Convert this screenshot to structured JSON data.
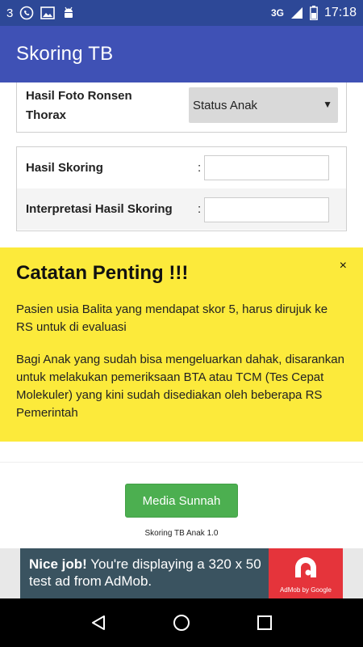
{
  "status_bar": {
    "notification_count": "3",
    "network": "3G",
    "time": "17:18",
    "icons": [
      "whatsapp-icon",
      "image-icon",
      "android-icon",
      "signal-icon",
      "battery-icon"
    ]
  },
  "app_bar": {
    "title": "Skoring TB",
    "color": "#3f51b5"
  },
  "form": {
    "xray_label": "Hasil Foto Ronsen Thorax",
    "xray_select_value": "Status Anak",
    "score_label": "Hasil Skoring",
    "score_colon": ":",
    "score_value": "",
    "interpretation_label": "Interpretasi Hasil Skoring",
    "interpretation_colon": ":",
    "interpretation_value": ""
  },
  "notice": {
    "title": "Catatan Penting !!!",
    "close": "×",
    "paragraph1": "Pasien usia Balita yang mendapat skor 5, harus dirujuk ke RS untuk di evaluasi",
    "paragraph2": "Bagi Anak yang sudah bisa mengeluarkan dahak, disarankan untuk melakukan pemeriksaan BTA atau TCM (Tes Cepat Molekuler) yang kini sudah disediakan oleh beberapa RS Pemerintah",
    "color": "#fcea3b"
  },
  "footer": {
    "button_label": "Media Sunnah",
    "button_color": "#4caf50",
    "version": "Skoring TB Anak 1.0"
  },
  "ad": {
    "headline": "Nice job!",
    "body": " You're displaying a 320 x 50 test ad from AdMob.",
    "brand": "AdMob by Google"
  }
}
